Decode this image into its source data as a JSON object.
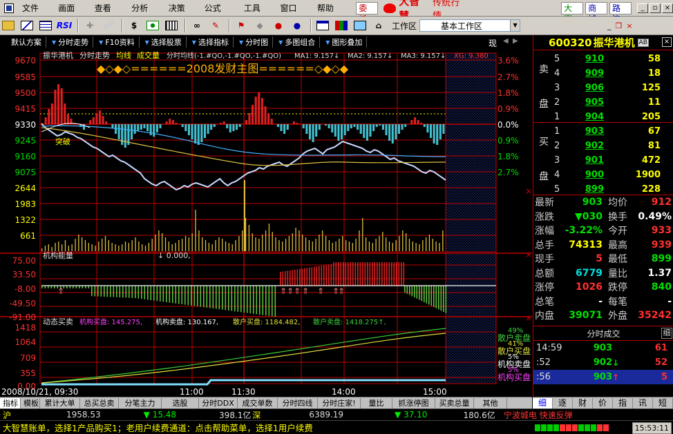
{
  "menubar": {
    "items": [
      "文件(F)",
      "画面(P)",
      "查看(V)",
      "分析(A)",
      "决策(L)",
      "公式(W)",
      "工具(T)",
      "窗口(B)",
      "帮助(H)"
    ],
    "entrust": "委托",
    "brand_big": "大智慧",
    "brand_small": "传统行情",
    "btn_contest": "大赛",
    "btn_mall": "商城",
    "btn_traffic": "路演"
  },
  "toolbar": {
    "workspace_label": "工作区",
    "workspace_value": "基本工作区"
  },
  "tabbar": {
    "items": [
      "默认方案",
      "分时走势",
      "F10资料",
      "选择股票",
      "选择指标",
      "分时图",
      "多图组合",
      "图形叠加"
    ],
    "right": "现"
  },
  "chart": {
    "header_name": "振华港机",
    "header_mode": "分时走势",
    "header_avg": "均线",
    "header_vol": "成交量",
    "header_params": "分时均线(-1.#QO,-1.#QO,-1.#QO)",
    "ma1": "MA1: 9.157↓",
    "ma2": "MA2: 9.157↓",
    "ma3": "MA3: 9.157↓",
    "xg": "XG: 9.380",
    "banner": "◆◇◆◇======2008发财主图======◇◆◇◆",
    "breakout": "突破",
    "price_labels": [
      "9670",
      "9585",
      "9500",
      "9415",
      "9330",
      "9245",
      "9160",
      "9075"
    ],
    "pct_labels": [
      "3.6%",
      "2.7%",
      "1.8%",
      "0.9%",
      "0.0%",
      "0.9%",
      "1.8%",
      "2.7%"
    ],
    "vol_labels": [
      "2644",
      "1983",
      "1322",
      "661"
    ],
    "energy_title": "机构能量",
    "energy_value": "↓ 0.000,",
    "energy_labels": [
      "75.00",
      "33.50",
      "-8.00",
      "-49.50",
      "-91.00"
    ],
    "dyn_title": "动态买卖",
    "dyn_items": [
      "机构买盘: 145.275,",
      "机构卖盘: 130.167,",
      "散户买盘: 1184.482,",
      "散户卖盘: 1418.275↑,"
    ],
    "dyn_labels": [
      "1418",
      "1064",
      "709",
      "355",
      "0.00"
    ],
    "side_legend": [
      {
        "pct": "49%",
        "label": "散户卖盘",
        "color": "#3cd23c"
      },
      {
        "pct": "41%",
        "label": "散户买盘",
        "color": "#e0e040"
      },
      {
        "pct": "5%",
        "label": "机构卖盘",
        "color": "#ffffff"
      },
      {
        "pct": "5%",
        "label": "机构买盘",
        "color": "#ff44ff"
      }
    ],
    "time_labels": [
      "2008/10/21, 09:30",
      "11:00",
      "11:30",
      "14:00",
      "15:00"
    ]
  },
  "quote": {
    "code": "600320",
    "name": "振华港机",
    "tag": "AB",
    "sell_label": [
      "卖",
      "盘"
    ],
    "buy_label": [
      "买",
      "盘"
    ],
    "asks": [
      {
        "lv": "5",
        "px": "910",
        "vol": "58"
      },
      {
        "lv": "4",
        "px": "909",
        "vol": "18"
      },
      {
        "lv": "3",
        "px": "906",
        "vol": "125"
      },
      {
        "lv": "2",
        "px": "905",
        "vol": "11"
      },
      {
        "lv": "1",
        "px": "904",
        "vol": "205"
      }
    ],
    "bids": [
      {
        "lv": "1",
        "px": "903",
        "vol": "67"
      },
      {
        "lv": "2",
        "px": "902",
        "vol": "81"
      },
      {
        "lv": "3",
        "px": "901",
        "vol": "472"
      },
      {
        "lv": "4",
        "px": "900",
        "vol": "1900"
      },
      {
        "lv": "5",
        "px": "899",
        "vol": "228"
      }
    ],
    "stats": [
      {
        "k": "最新",
        "v": "903",
        "vc": "#00e000",
        "k2": "均价",
        "v2": "912",
        "v2c": "#ff3030"
      },
      {
        "k": "涨跌",
        "v": "▼030",
        "vc": "#00e000",
        "k2": "换手",
        "v2": "0.49%",
        "v2c": "#ffffff"
      },
      {
        "k": "涨幅",
        "v": "-3.22%",
        "vc": "#00e000",
        "k2": "今开",
        "v2": "933",
        "v2c": "#ff3030"
      },
      {
        "k": "总手",
        "v": "74313",
        "vc": "#ffff00",
        "k2": "最高",
        "v2": "939",
        "v2c": "#ff3030"
      },
      {
        "k": "现手",
        "v": "5",
        "vc": "#ff3030",
        "k2": "最低",
        "v2": "899",
        "v2c": "#00e000"
      },
      {
        "k": "总额",
        "v": "6779",
        "vc": "#00e0e0",
        "k2": "量比",
        "v2": "1.37",
        "v2c": "#ffffff"
      },
      {
        "k": "涨停",
        "v": "1026",
        "vc": "#ff3030",
        "k2": "跌停",
        "v2": "840",
        "v2c": "#00e000"
      },
      {
        "k": "总笔",
        "v": "-",
        "vc": "#ffffff",
        "k2": "每笔",
        "v2": "-",
        "v2c": "#ffffff"
      },
      {
        "k": "内盘",
        "v": "39071",
        "vc": "#00e000",
        "k2": "外盘",
        "v2": "35242",
        "v2c": "#ff3030"
      }
    ],
    "ticks_title": "分时成交",
    "ticks_mini": "细",
    "ticks": [
      {
        "t": "14:59",
        "p": "903",
        "a": "",
        "ac": "#00e000",
        "v": "61",
        "vc": "#ff3030"
      },
      {
        "t": ":52",
        "p": "902",
        "a": "↓",
        "ac": "#00e000",
        "v": "52",
        "vc": "#ff3030"
      },
      {
        "t": ":56",
        "p": "903",
        "a": "↑",
        "ac": "#ff3030",
        "v": "5",
        "vc": "#ff3030"
      }
    ]
  },
  "bottom_tabs": [
    "指标",
    "模板",
    "累计大单",
    "总买总卖",
    "分笔主力",
    "选股",
    "分时DDX",
    "成交单数",
    "分时四线",
    "分时庄家!",
    "量比",
    "抓涨停图",
    "买卖总量",
    "其他"
  ],
  "right_tabs": [
    "细",
    "逐",
    "财",
    "价",
    "指",
    "讯",
    "短"
  ],
  "ticker": {
    "sh": "沪",
    "sh_val": "1958.53",
    "sh_chg": "▼ 15.48",
    "sh_amt": "398.1亿",
    "sz": "深",
    "sz_val": "6389.19",
    "sz_chg": "▼ 37.10",
    "sz_amt": "180.6亿",
    "news": "宁波城电 快速反弹"
  },
  "status": {
    "text": "大智慧账单，选择1产品购买1；老用户续费通道：点击帮助菜单，选择1用户续费",
    "clock": "15:53:11"
  }
}
